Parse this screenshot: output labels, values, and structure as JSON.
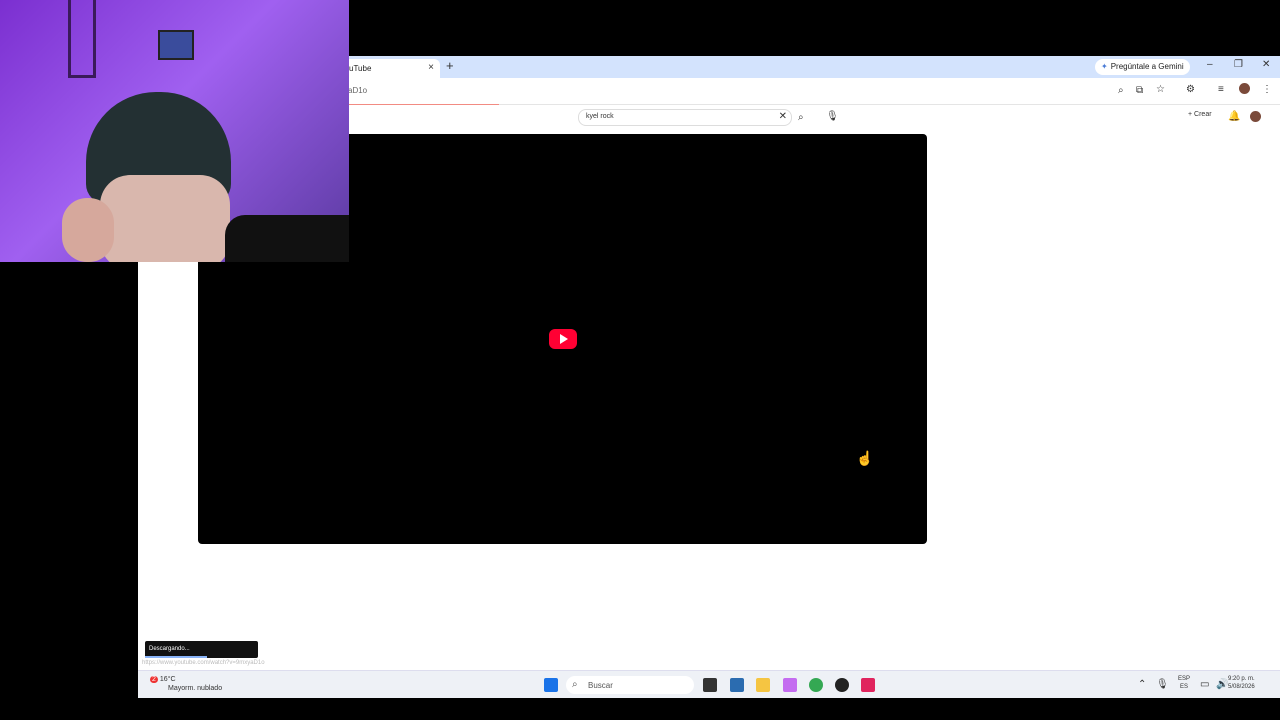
{
  "browser": {
    "tab_title": "uTube",
    "tab_close": "×",
    "new_tab": "+",
    "gemini_label": "Pregúntale a Gemini",
    "url_fragment": "aD1o",
    "window_controls": [
      "–",
      "❐",
      "✕"
    ]
  },
  "youtube": {
    "search_value": "kyel rock",
    "clear_symbol": "✕",
    "create_label": "Crear"
  },
  "video": {
    "play_icon": "youtube-play-icon"
  },
  "download": {
    "status": "Descargando...",
    "progress": 0.55,
    "hover_url": "https://www.youtube.com/watch?v=9mxyaD1o"
  },
  "taskbar": {
    "weather_badge": "2",
    "temperature": "16°C",
    "weather_desc": "Mayorm. nublado",
    "search_placeholder": "Buscar",
    "language_top": "ESP",
    "language_bottom": "ES",
    "time": "9:20 p. m.",
    "date": "5/08/2026"
  },
  "colors": {
    "tabstrip": "#d3e3fd",
    "play_red": "#ff0033",
    "taskbar": "#eef1f6"
  }
}
